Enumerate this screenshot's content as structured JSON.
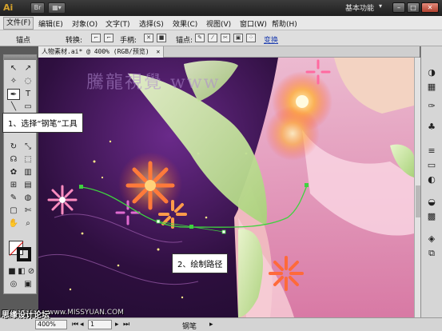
{
  "app": {
    "logo": "Ai",
    "title_buttons": [
      "Br",
      "▦▾"
    ],
    "workspace": "基本功能",
    "workspace_arrow": "▾",
    "window_controls": [
      "–",
      "□",
      "✕"
    ]
  },
  "menu": [
    "文件(F)",
    "编辑(E)",
    "对象(O)",
    "文字(T)",
    "选择(S)",
    "效果(C)",
    "视图(V)",
    "窗口(W)",
    "帮助(H)"
  ],
  "control_bar": {
    "anchor_label": "锚点",
    "convert_label": "转换:",
    "handles_label": "手柄:",
    "anchor2_label": "锚点:",
    "transform_link": "变换"
  },
  "document": {
    "tab_title": "人物素材.ai* @ 400% (RGB/预览)",
    "tab_close": "✕",
    "canvas_watermark": "騰龍視覺 www"
  },
  "callouts": {
    "step1": "1、选择“钢笔”工具",
    "step2": "2、绘制路径"
  },
  "status": {
    "zoom": "400%",
    "page": "1",
    "tool_name": "钢笔"
  },
  "footer_watermark": {
    "brand": "思缘设计论坛",
    "url": "www.MISSYUAN.COM"
  },
  "colors": {
    "accent": "#d4a22c",
    "path_stroke": "#3fd23f",
    "leaf": "#c6e6a0"
  }
}
